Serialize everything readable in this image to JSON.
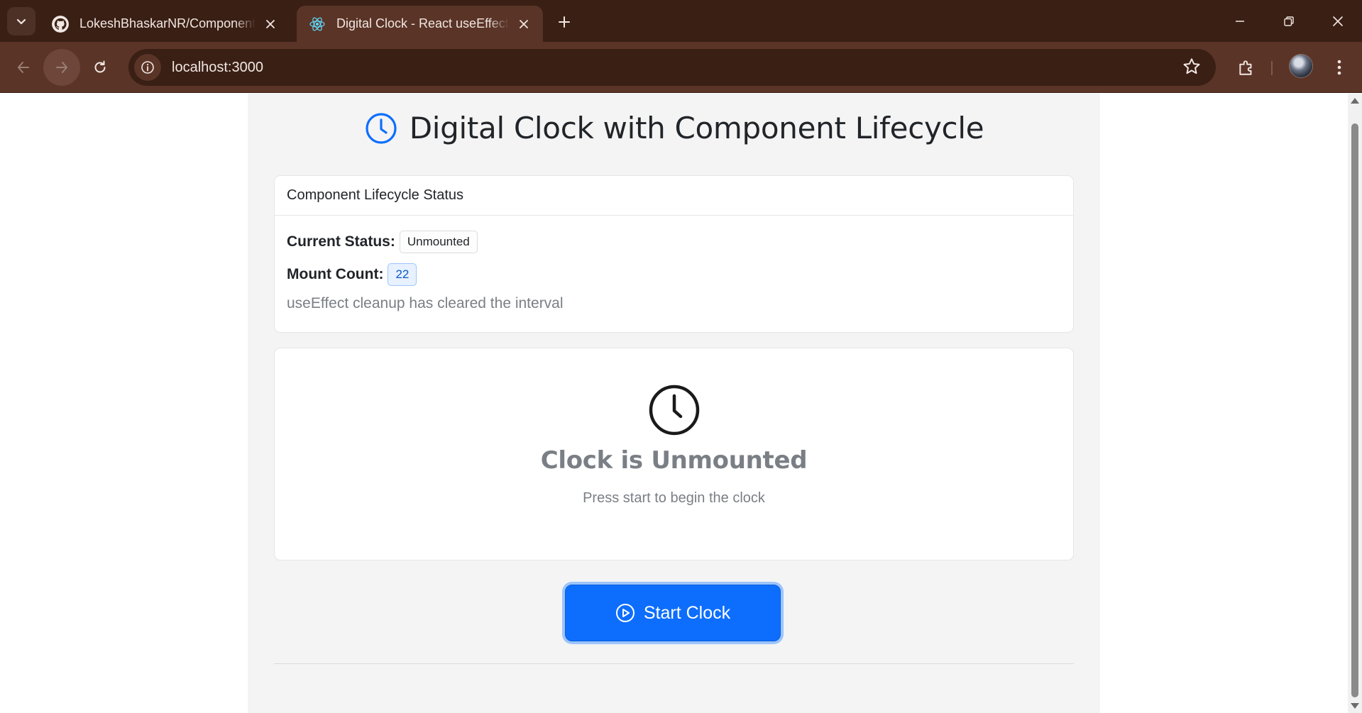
{
  "browser": {
    "tabs": [
      {
        "title": "LokeshBhaskarNR/Component_",
        "favicon": "github-icon",
        "active": false
      },
      {
        "title": "Digital Clock - React useEffect Demo",
        "favicon": "react-icon",
        "active": true
      }
    ],
    "url": "localhost:3000"
  },
  "page": {
    "title": "Digital Clock with Component Lifecycle",
    "status_card": {
      "header": "Component Lifecycle Status",
      "current_status_label": "Current Status:",
      "current_status_value": "Unmounted",
      "mount_count_label": "Mount Count:",
      "mount_count_value": "22",
      "note": "useEffect cleanup has cleared the interval"
    },
    "clock_card": {
      "title": "Clock is Unmounted",
      "subtitle": "Press start to begin the clock"
    },
    "start_button_label": "Start Clock"
  },
  "colors": {
    "accent": "#0d6efd",
    "chrome_dark": "#3a1f14",
    "chrome_mid": "#5a3427",
    "page_bg": "#f4f4f4"
  }
}
